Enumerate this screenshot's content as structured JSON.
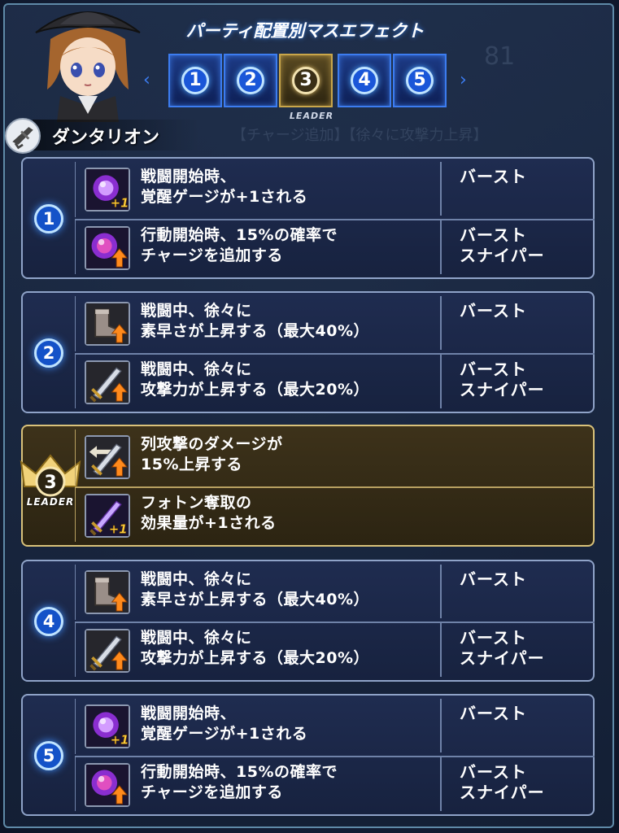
{
  "header": {
    "title": "パーティ配置別マスエフェクト",
    "character_name": "ダンタリオン",
    "leader_tag": "LEADER",
    "slots": [
      {
        "num": "1",
        "leader": false
      },
      {
        "num": "2",
        "leader": false
      },
      {
        "num": "3",
        "leader": true
      },
      {
        "num": "4",
        "leader": false
      },
      {
        "num": "5",
        "leader": false
      }
    ],
    "background_faint_text": [
      "81",
      "【チャージ追加】【徐々に攻撃力上昇】"
    ]
  },
  "colors": {
    "slot_blue": "#1a56d8",
    "leader_gold": "#d9c27a",
    "panel_border": "#8fa3c8"
  },
  "groups": [
    {
      "position": "1",
      "leader": false,
      "rows": [
        {
          "icon": "purple-orb-plus1-icon",
          "desc": "戦闘開始時、\n覚醒ゲージが+1される",
          "type": "バースト"
        },
        {
          "icon": "purple-orb-arrow-up-icon",
          "desc": "行動開始時、15%の確率で\nチャージを追加する",
          "type": "バースト\nスナイパー"
        }
      ]
    },
    {
      "position": "2",
      "leader": false,
      "rows": [
        {
          "icon": "boot-arrow-up-icon",
          "desc": "戦闘中、徐々に\n素早さが上昇する（最大40%）",
          "type": "バースト"
        },
        {
          "icon": "sword-arrow-up-icon",
          "desc": "戦闘中、徐々に\n攻撃力が上昇する（最大20%）",
          "type": "バースト\nスナイパー"
        }
      ]
    },
    {
      "position": "3",
      "leader": true,
      "leader_label": "LEADER",
      "rows": [
        {
          "icon": "row-attack-arrow-up-icon",
          "desc": "列攻撃のダメージが\n15%上昇する",
          "type": ""
        },
        {
          "icon": "purple-sword-plus1-icon",
          "desc": "フォトン奪取の\n効果量が+1される",
          "type": ""
        }
      ]
    },
    {
      "position": "4",
      "leader": false,
      "rows": [
        {
          "icon": "boot-arrow-up-icon",
          "desc": "戦闘中、徐々に\n素早さが上昇する（最大40%）",
          "type": "バースト"
        },
        {
          "icon": "sword-arrow-up-icon",
          "desc": "戦闘中、徐々に\n攻撃力が上昇する（最大20%）",
          "type": "バースト\nスナイパー"
        }
      ]
    },
    {
      "position": "5",
      "leader": false,
      "rows": [
        {
          "icon": "purple-orb-plus1-icon",
          "desc": "戦闘開始時、\n覚醒ゲージが+1される",
          "type": "バースト"
        },
        {
          "icon": "purple-orb-arrow-up-icon",
          "desc": "行動開始時、15%の確率で\nチャージを追加する",
          "type": "バースト\nスナイパー"
        }
      ]
    }
  ]
}
